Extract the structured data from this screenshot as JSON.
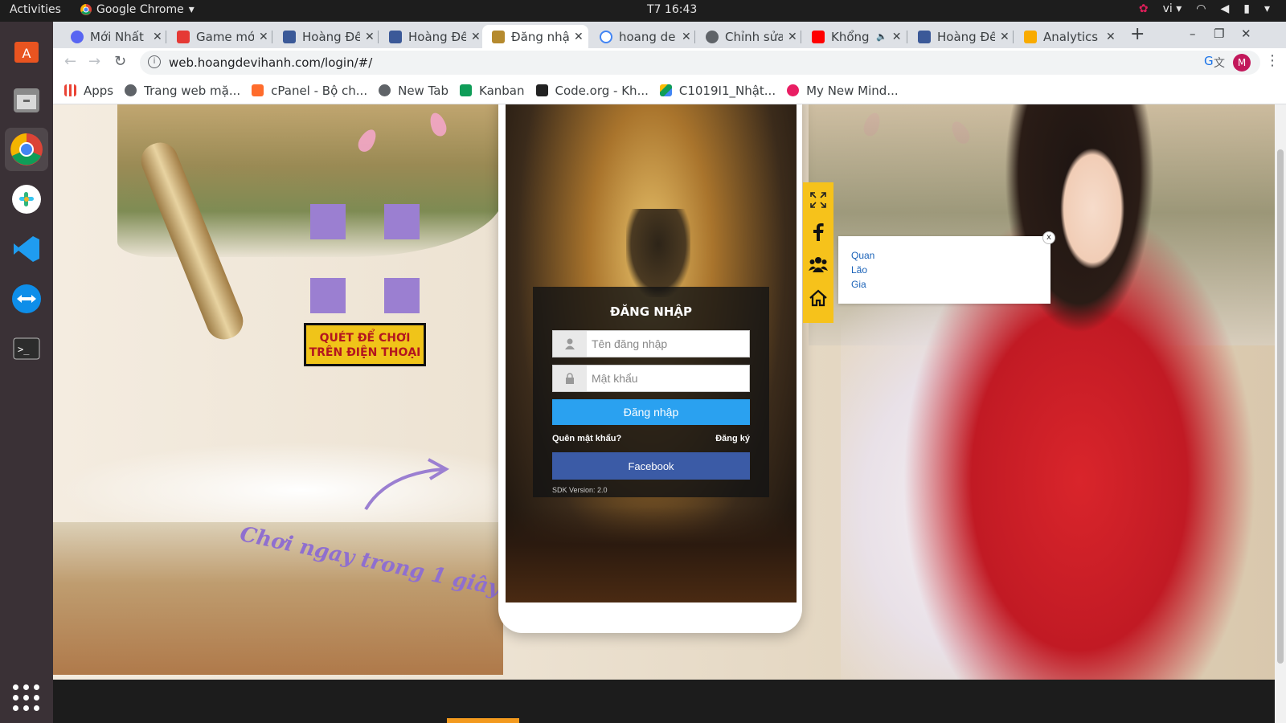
{
  "system": {
    "activities": "Activities",
    "app_name": "Google Chrome",
    "clock": "T7 16:43",
    "lang": "vi"
  },
  "browser": {
    "tabs": [
      {
        "label": "Mới Nhất",
        "fav_color": "#5865f2"
      },
      {
        "label": "Game mới",
        "fav_color": "#e53935"
      },
      {
        "label": "Hoàng Đế",
        "fav_color": "#3b5998"
      },
      {
        "label": "Hoàng Đế",
        "fav_color": "#3b5998"
      },
      {
        "label": "Đăng nhập",
        "fav_color": "#b58a2e"
      },
      {
        "label": "hoang de",
        "fav_color": "#4285f4"
      },
      {
        "label": "Chỉnh sửa",
        "fav_color": "#5f6368"
      },
      {
        "label": "Khổng",
        "fav_color": "#ff0000"
      },
      {
        "label": "Hoàng Đế",
        "fav_color": "#3b5998"
      },
      {
        "label": "Analytics",
        "fav_color": "#f9ab00"
      }
    ],
    "url": "web.hoangdevihanh.com/login/#/",
    "avatar_letter": "M",
    "bookmarks": [
      {
        "label": "Apps",
        "color": "#ea4335"
      },
      {
        "label": "Trang web mặ...",
        "color": "#5f6368"
      },
      {
        "label": "cPanel - Bộ ch...",
        "color": "#ff6c2c"
      },
      {
        "label": "New Tab",
        "color": "#5f6368"
      },
      {
        "label": "Kanban",
        "color": "#0f9d58"
      },
      {
        "label": "Code.org - Kh...",
        "color": "#222222"
      },
      {
        "label": "C1019I1_Nhật...",
        "color": "#fbbc04"
      },
      {
        "label": "My New Mind...",
        "color": "#e91e63"
      }
    ]
  },
  "game": {
    "qr_button": [
      "QUÉT ĐỂ CHƠI",
      "TRÊN ĐIỆN THOẠI"
    ],
    "play_now": "Chơi ngay trong 1 giây",
    "login": {
      "title": "ĐĂNG NHẬP",
      "username_placeholder": "Tên đăng nhập",
      "password_placeholder": "Mật khẩu",
      "submit": "Đăng nhập",
      "forgot": "Quên mật khẩu?",
      "register": "Đăng ký",
      "facebook": "Facebook",
      "sdk": "SDK Version: 2.0"
    },
    "side_tools": [
      "fullscreen-icon",
      "facebook-icon",
      "group-icon",
      "home-icon"
    ],
    "popup": {
      "close": "x",
      "lines": [
        "Quan",
        "Lão",
        "Gia"
      ]
    }
  }
}
